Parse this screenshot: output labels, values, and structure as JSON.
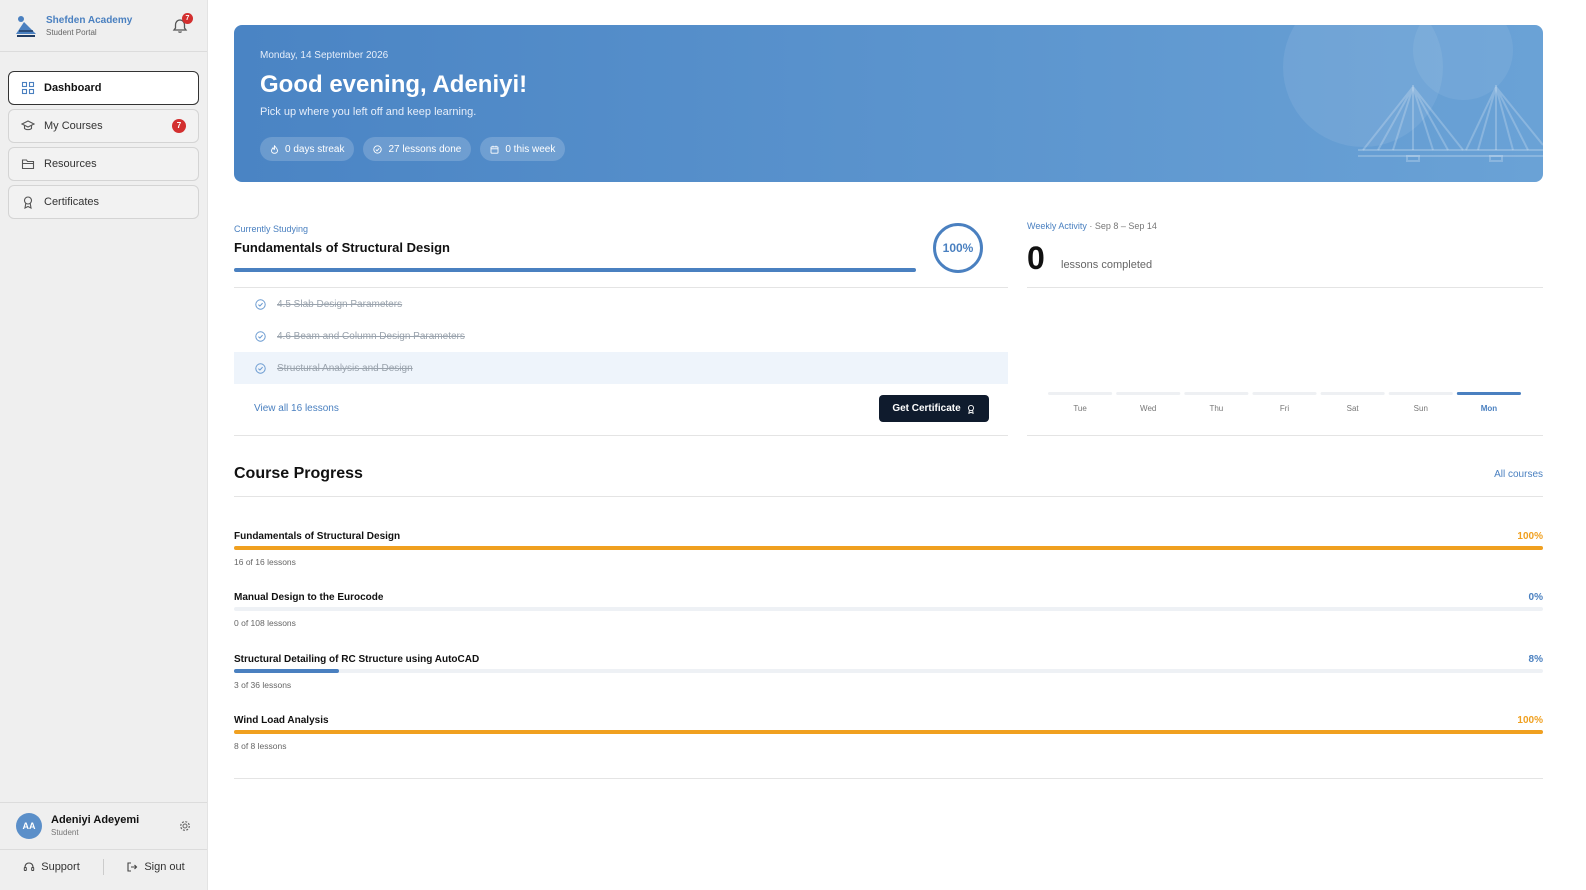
{
  "brand": {
    "name": "Shefden Academy",
    "subtitle": "Student Portal",
    "notifications": "7"
  },
  "nav": [
    {
      "label": "Dashboard",
      "active": true
    },
    {
      "label": "My Courses",
      "badge": "7"
    },
    {
      "label": "Resources"
    },
    {
      "label": "Certificates"
    }
  ],
  "user": {
    "initials": "AA",
    "name": "Adeniyi Adeyemi",
    "role": "Student"
  },
  "footer": {
    "support": "Support",
    "signout": "Sign out"
  },
  "hero": {
    "date": "Monday, 14 September 2026",
    "greeting": "Good evening, Adeniyi!",
    "subtitle": "Pick up where you left off and keep learning.",
    "chips": {
      "streak": "0 days streak",
      "lessons": "27 lessons done",
      "week": "0 this week"
    }
  },
  "current": {
    "label": "Currently Studying",
    "title": "Fundamentals of Structural Design",
    "percent_text": "100%",
    "progress": 1.0,
    "lessons": [
      "4.5 Slab Design Parameters",
      "4.6 Beam and Column Design Parameters",
      "Structural Analysis and Design"
    ],
    "view_all": "View all 16 lessons",
    "certificate_button": "Get Certificate"
  },
  "weekly": {
    "label": "Weekly Activity",
    "range": " · Sep 8 – Sep 14",
    "count": "0",
    "count_label": "lessons completed",
    "days": [
      "Tue",
      "Wed",
      "Thu",
      "Fri",
      "Sat",
      "Sun",
      "Mon"
    ],
    "today": "Mon"
  },
  "progress": {
    "title": "Course Progress",
    "all_link": "All courses",
    "courses": [
      {
        "name": "Fundamentals of Structural Design",
        "percent": "100%",
        "value": 1.0,
        "meta": "16 of 16 lessons",
        "color": "#f0a020"
      },
      {
        "name": "Manual Design to the Eurocode",
        "percent": "0%",
        "value": 0.0,
        "meta": "0 of 108 lessons",
        "color": "#4a80c0"
      },
      {
        "name": "Structural Detailing of RC Structure using AutoCAD",
        "percent": "8%",
        "value": 0.08,
        "meta": "3 of 36 lessons",
        "color": "#4a80c0"
      },
      {
        "name": "Wind Load Analysis",
        "percent": "100%",
        "value": 1.0,
        "meta": "8 of 8 lessons",
        "color": "#f0a020"
      }
    ]
  },
  "colors": {
    "accent": "#4a80c0",
    "complete": "#f0a020",
    "dark": "#0f1b2d",
    "badge": "#d32f2f"
  }
}
